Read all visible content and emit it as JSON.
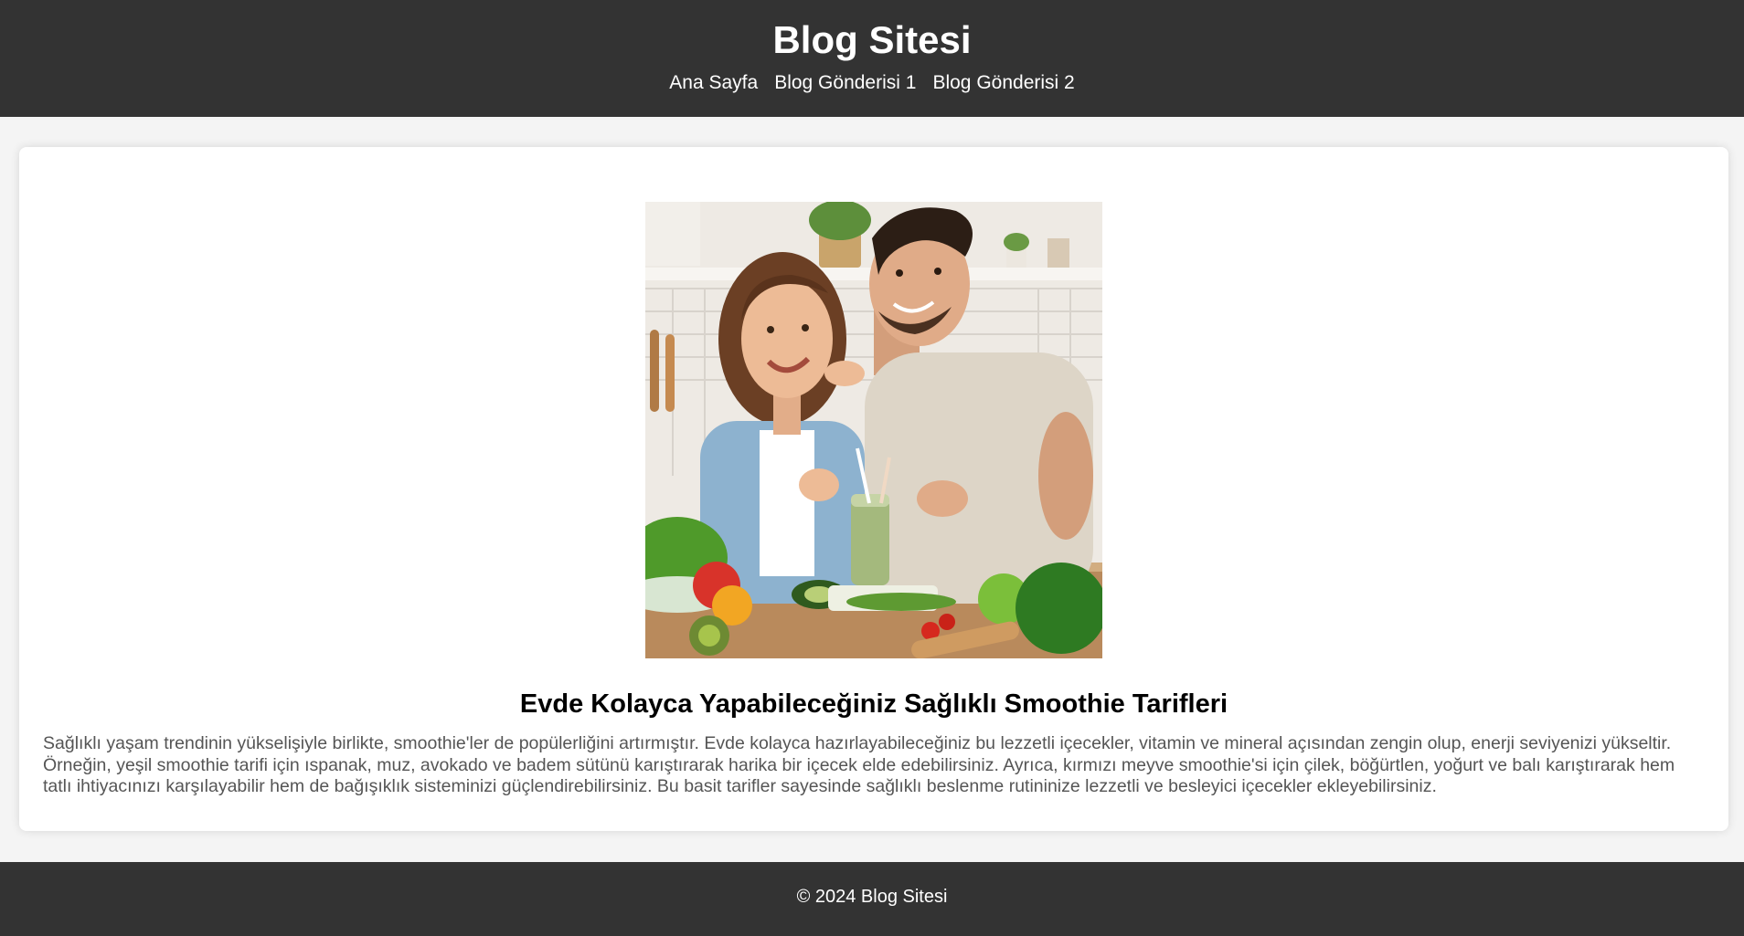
{
  "header": {
    "title": "Blog Sitesi",
    "nav": [
      {
        "label": "Ana Sayfa"
      },
      {
        "label": "Blog Gönderisi 1"
      },
      {
        "label": "Blog Gönderisi 2"
      }
    ]
  },
  "post": {
    "image_subject": "couple-making-green-smoothie-in-kitchen",
    "title": "Evde Kolayca Yapabileceğiniz Sağlıklı Smoothie Tarifleri",
    "body": "Sağlıklı yaşam trendinin yükselişiyle birlikte, smoothie'ler de popülerliğini artırmıştır. Evde kolayca hazırlayabileceğiniz bu lezzetli içecekler, vitamin ve mineral açısından zengin olup, enerji seviyenizi yükseltir. Örneğin, yeşil smoothie tarifi için ıspanak, muz, avokado ve badem sütünü karıştırarak harika bir içecek elde edebilirsiniz. Ayrıca, kırmızı meyve smoothie'si için çilek, böğürtlen, yoğurt ve balı karıştırarak hem tatlı ihtiyacınızı karşılayabilir hem de bağışıklık sisteminizi güçlendirebilirsiniz. Bu basit tarifler sayesinde sağlıklı beslenme rutininize lezzetli ve besleyici içecekler ekleyebilirsiniz."
  },
  "footer": {
    "text": "© 2024 Blog Sitesi"
  },
  "colors": {
    "header_bg": "#333333",
    "page_bg": "#f4f4f4",
    "card_bg": "#ffffff",
    "body_text": "#555555"
  }
}
